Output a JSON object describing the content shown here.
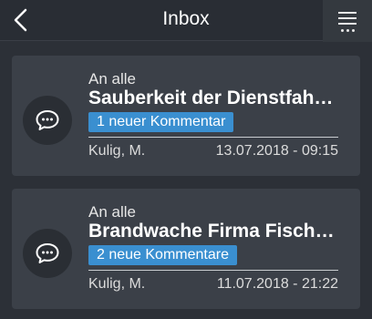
{
  "header": {
    "title": "Inbox",
    "back_icon": "chevron-left-icon",
    "menu_icon": "hamburger-menu-icon"
  },
  "messages": [
    {
      "recipient": "An alle",
      "subject": "Sauberkeit der Dienstfah…",
      "comments": "1 neuer Kommentar",
      "author": "Kulig, M.",
      "date": "13.07.2018 - 09:15"
    },
    {
      "recipient": "An alle",
      "subject": "Brandwache Firma Fisch…",
      "comments": "2 neue Kommentare",
      "author": "Kulig, M.",
      "date": "11.07.2018 - 21:22"
    }
  ],
  "colors": {
    "background": "#2c3037",
    "card": "#3b4048",
    "badge": "#3a8fd0"
  }
}
